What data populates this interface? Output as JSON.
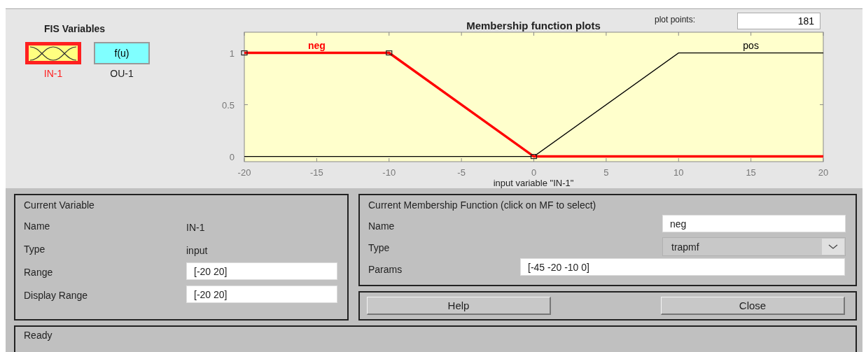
{
  "fis_variables": {
    "title": "FIS Variables",
    "items": [
      {
        "kind": "input",
        "label": "IN-1",
        "selected": true
      },
      {
        "kind": "output",
        "icon_text": "f(u)",
        "label": "OU-1",
        "selected": false
      }
    ]
  },
  "plot": {
    "curves": [
      {
        "selected": true
      },
      {
        "selected": false
      }
    ],
    "plot_points_label": "plot points:",
    "plot_points": "181",
    "chart_data": {
      "type": "line",
      "title": "Membership function plots",
      "xlabel": "input variable \"IN-1\"",
      "x": [
        -20,
        -10,
        0,
        10,
        20
      ],
      "series": [
        {
          "name": "neg",
          "color": "#ff0000",
          "values": [
            1,
            1,
            0,
            0,
            0
          ]
        },
        {
          "name": "pos",
          "color": "#000000",
          "values": [
            0,
            0,
            0,
            1,
            1
          ]
        }
      ],
      "xlim": [
        -20,
        20
      ],
      "ylim": [
        -0.05,
        1.2
      ],
      "xticks": [
        -20,
        -15,
        -10,
        -5,
        0,
        5,
        10,
        15,
        20
      ],
      "yticks": [
        0,
        0.5,
        1
      ]
    }
  },
  "current_variable": {
    "title": "Current Variable",
    "fields": [
      {
        "kind": "text",
        "label": "Name",
        "value": "IN-1"
      },
      {
        "kind": "text",
        "label": "Type",
        "value": "input"
      },
      {
        "kind": "input",
        "label": "Range",
        "value": "[-20 20]"
      },
      {
        "kind": "input",
        "label": "Display Range",
        "value": "[-20 20]"
      }
    ]
  },
  "current_mf": {
    "title": "Current Membership Function (click on MF to select)",
    "fields": [
      {
        "kind": "input",
        "label": "Name",
        "value": "neg"
      },
      {
        "kind": "dropdown",
        "label": "Type",
        "value": "trapmf"
      },
      {
        "kind": "wide_input",
        "label": "Params",
        "value": "[-45 -20 -10 0]"
      }
    ]
  },
  "buttons": [
    "Help",
    "Close"
  ],
  "status": "Ready"
}
